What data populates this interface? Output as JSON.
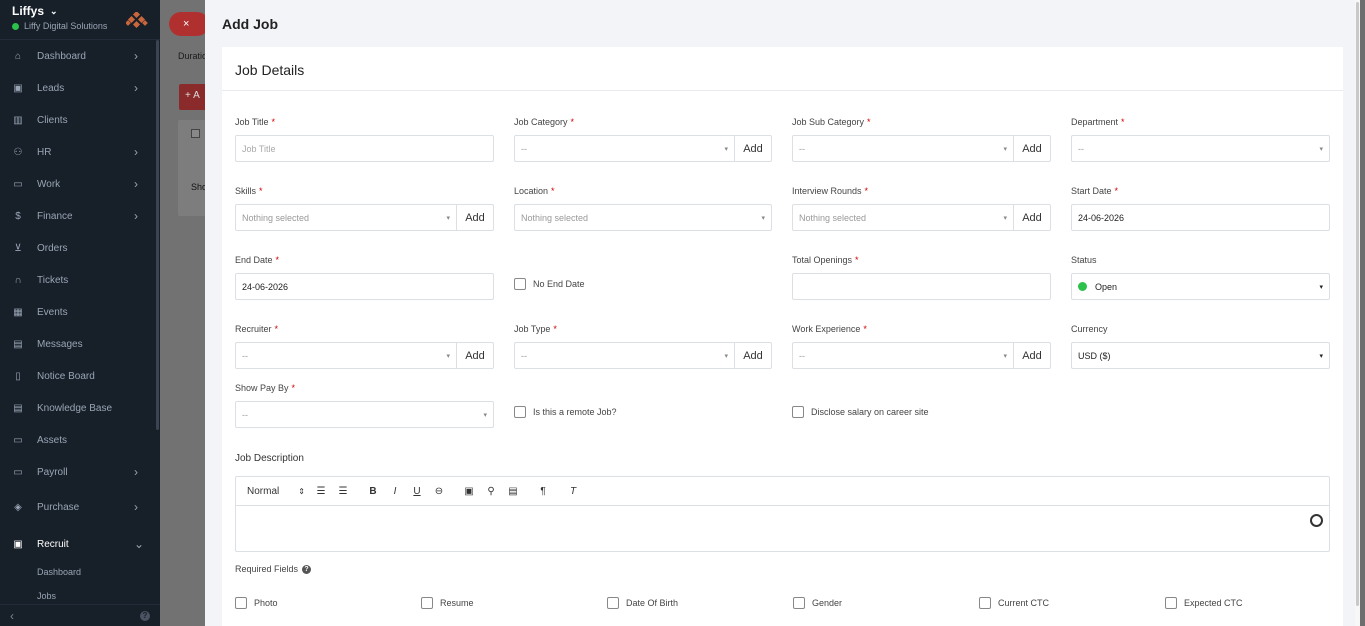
{
  "sidebar": {
    "company": "Liffys",
    "company_sub": "Liffy Digital Solutions",
    "items": [
      {
        "label": "Dashboard",
        "icon": "home-icon",
        "chev": true
      },
      {
        "label": "Leads",
        "icon": "contact-icon",
        "chev": true
      },
      {
        "label": "Clients",
        "icon": "chart-icon",
        "chev": false
      },
      {
        "label": "HR",
        "icon": "people-icon",
        "chev": true
      },
      {
        "label": "Work",
        "icon": "briefcase-icon",
        "chev": true
      },
      {
        "label": "Finance",
        "icon": "dollar-icon",
        "chev": true
      },
      {
        "label": "Orders",
        "icon": "cart-icon",
        "chev": false
      },
      {
        "label": "Tickets",
        "icon": "headset-icon",
        "chev": false
      },
      {
        "label": "Events",
        "icon": "calendar-icon",
        "chev": false
      },
      {
        "label": "Messages",
        "icon": "message-icon",
        "chev": false
      },
      {
        "label": "Notice Board",
        "icon": "clipboard-icon",
        "chev": false
      },
      {
        "label": "Knowledge Base",
        "icon": "book-icon",
        "chev": false
      },
      {
        "label": "Assets",
        "icon": "monitor-icon",
        "chev": false
      },
      {
        "label": "Payroll",
        "icon": "wallet-icon",
        "chev": true
      },
      {
        "label": "Purchase",
        "icon": "layers-icon",
        "chev": true
      },
      {
        "label": "Recruit",
        "icon": "badge-icon",
        "chev": true
      }
    ],
    "sub_items": [
      "Dashboard",
      "Jobs"
    ]
  },
  "background": {
    "close_label": "×",
    "duration_label": "Duratio",
    "add_label": "+ A",
    "show_label": "Sho"
  },
  "panel": {
    "title": "Add Job",
    "card_title": "Job Details"
  },
  "form": {
    "job_title": {
      "label": "Job Title",
      "placeholder": "Job Title"
    },
    "job_category": {
      "label": "Job Category",
      "value": "--",
      "add": "Add"
    },
    "job_sub_category": {
      "label": "Job Sub Category",
      "value": "--",
      "add": "Add"
    },
    "department": {
      "label": "Department",
      "value": "--"
    },
    "skills": {
      "label": "Skills",
      "value": "Nothing selected",
      "add": "Add"
    },
    "location": {
      "label": "Location",
      "value": "Nothing selected"
    },
    "interview_rounds": {
      "label": "Interview Rounds",
      "value": "Nothing selected",
      "add": "Add"
    },
    "start_date": {
      "label": "Start Date",
      "value": "24-06-2026"
    },
    "end_date": {
      "label": "End Date",
      "value": "24-06-2026"
    },
    "no_end_date": "No End Date",
    "total_openings": {
      "label": "Total Openings",
      "value": ""
    },
    "status": {
      "label": "Status",
      "value": "Open"
    },
    "recruiter": {
      "label": "Recruiter",
      "value": "--",
      "add": "Add"
    },
    "job_type": {
      "label": "Job Type",
      "value": "--",
      "add": "Add"
    },
    "work_experience": {
      "label": "Work Experience",
      "value": "--",
      "add": "Add"
    },
    "currency": {
      "label": "Currency",
      "value": "USD ($)"
    },
    "show_pay_by": {
      "label": "Show Pay By",
      "value": "--"
    },
    "remote_job": "Is this a remote Job?",
    "disclose_salary": "Disclose salary on career site",
    "job_description": {
      "label": "Job Description",
      "format": "Normal"
    },
    "required_fields": {
      "label": "Required Fields",
      "items": [
        "Photo",
        "Resume",
        "Date Of Birth",
        "Gender",
        "Current CTC",
        "Expected CTC"
      ]
    }
  },
  "colors": {
    "status_open": "#2bc14a",
    "required": "#d30000",
    "sidebar": "#171f29"
  }
}
